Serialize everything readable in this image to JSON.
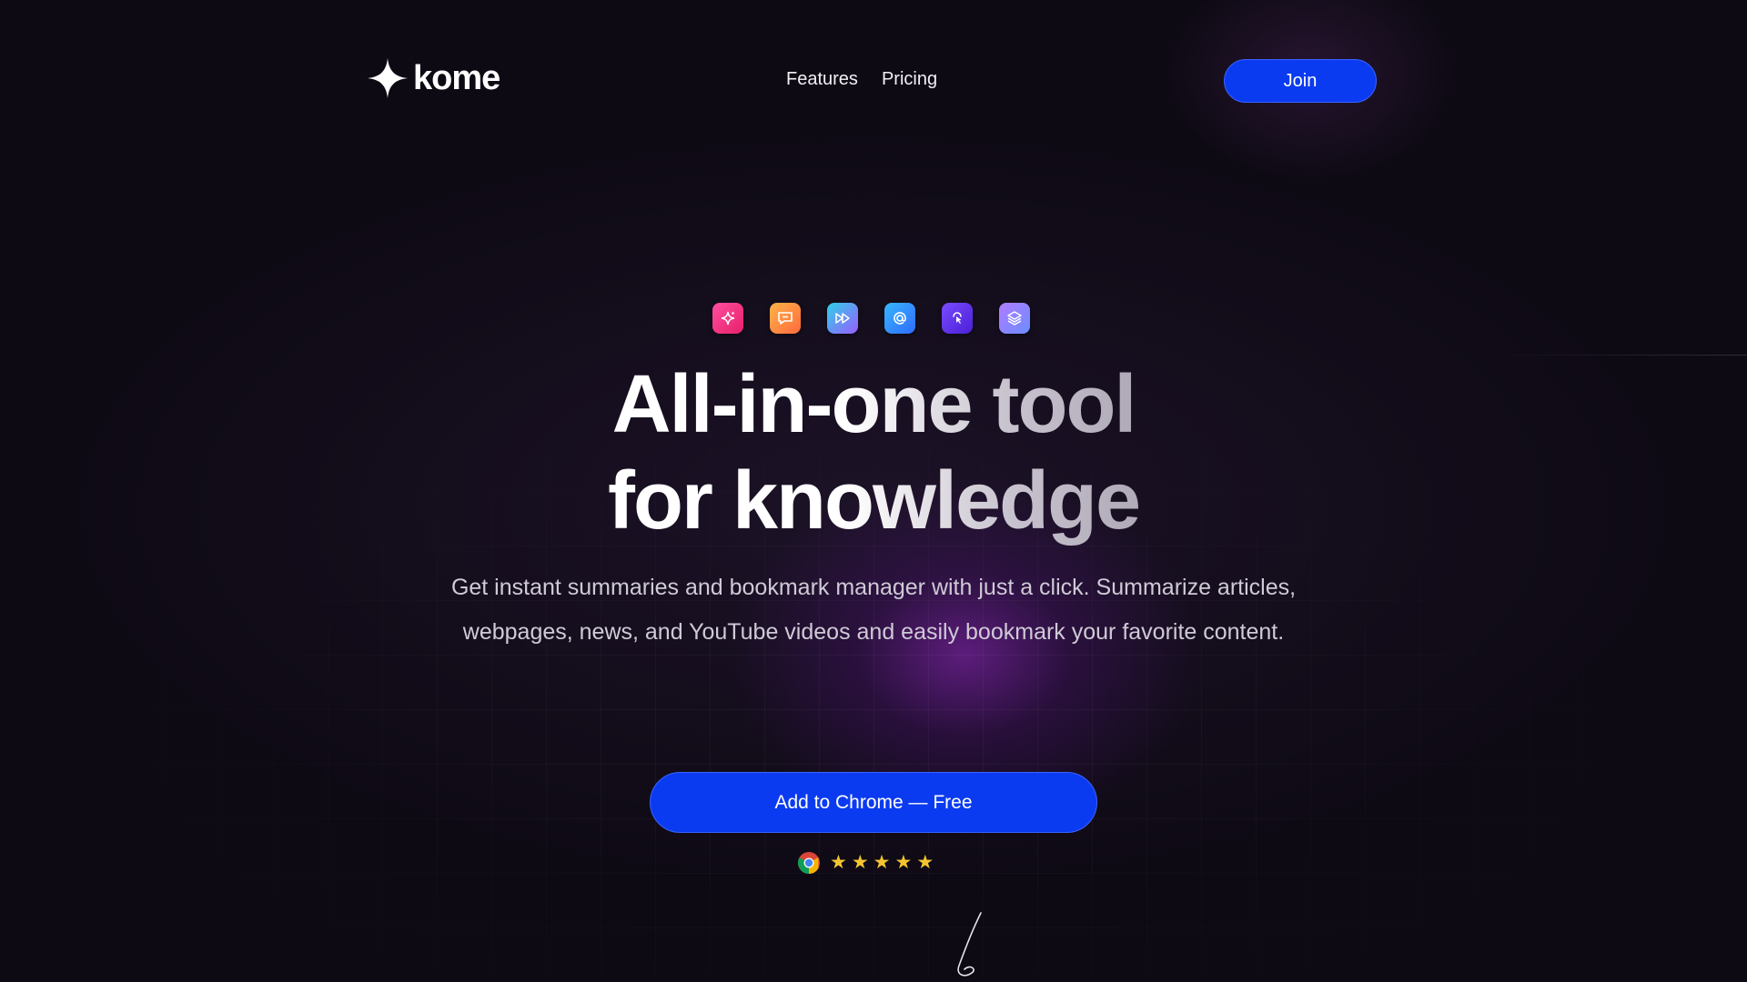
{
  "header": {
    "logo_text": "kome",
    "nav": [
      {
        "label": "Features"
      },
      {
        "label": "Pricing"
      }
    ],
    "join_label": "Join"
  },
  "hero": {
    "feature_icons": [
      {
        "name": "sparkle-icon",
        "color": "#e7206a"
      },
      {
        "name": "chat-icon",
        "color": "#ff6a3d"
      },
      {
        "name": "fast-forward-icon",
        "color": "#2ed1e8"
      },
      {
        "name": "at-sign-icon",
        "color": "#2f6bff"
      },
      {
        "name": "pointer-icon",
        "color": "#4a1fd6"
      },
      {
        "name": "layers-icon",
        "color": "#8b7cff"
      }
    ],
    "headline_line1": "All-in-one tool",
    "headline_line2": "for knowledge",
    "subtitle_line1": "Get instant summaries and bookmark manager with just a click. Summarize articles,",
    "subtitle_line2": "webpages, news, and YouTube videos and easily bookmark your favorite content.",
    "cta_label": "Add to Chrome — Free",
    "rating": {
      "store_icon": "chrome-icon",
      "stars": 5
    }
  },
  "colors": {
    "background": "#0e0a14",
    "accent": "#0b3bf0",
    "star": "#f4c430",
    "glow": "#9628c8"
  }
}
